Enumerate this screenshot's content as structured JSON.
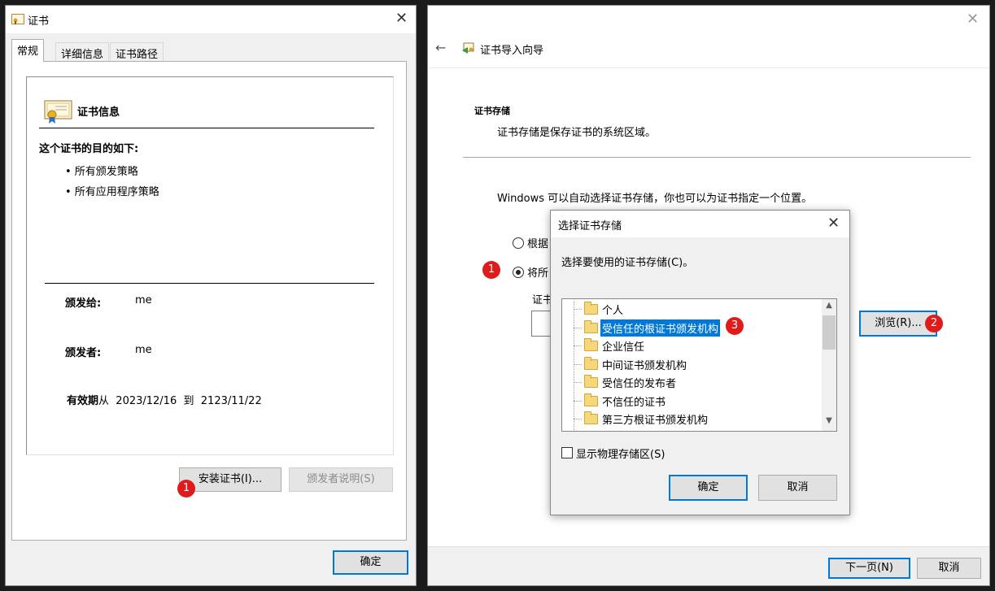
{
  "cert_window": {
    "title": "证书",
    "tabs": [
      "常规",
      "详细信息",
      "证书路径"
    ],
    "info_heading": "证书信息",
    "purpose_heading": "这个证书的目的如下:",
    "purposes": [
      "• 所有颁发策略",
      "• 所有应用程序策略"
    ],
    "issued_to_label": "颁发给:",
    "issued_to_value": "me",
    "issued_by_label": "颁发者:",
    "issued_by_value": "me",
    "validity_label_bold": "有效期",
    "validity_from": "从",
    "validity_start": "2023/12/16",
    "validity_to": "到",
    "validity_end": "2123/11/22",
    "install_button": "安装证书(I)...",
    "issuer_statement_button": "颁发者说明(S)",
    "ok_button": "确定",
    "badge": "1"
  },
  "wizard": {
    "title": "证书导入向导",
    "store_heading": "证书存储",
    "store_desc": "证书存储是保存证书的系统区域。",
    "auto_text": "Windows 可以自动选择证书存储，你也可以为证书指定一个位置。",
    "radio_auto_label": "根据",
    "radio_place_label": "将所",
    "store_label_fragment": "证书",
    "browse_button": "浏览(R)...",
    "next_button": "下一页(N)",
    "cancel_button": "取消",
    "badge1": "1",
    "badge2": "2"
  },
  "dialog": {
    "title": "选择证书存储",
    "prompt": "选择要使用的证书存储(C)。",
    "stores": [
      "个人",
      "受信任的根证书颁发机构",
      "企业信任",
      "中间证书颁发机构",
      "受信任的发布者",
      "不信任的证书",
      "第三方根证书颁发机构"
    ],
    "selected_index": 1,
    "show_physical_label": "显示物理存储区(S)",
    "ok_button": "确定",
    "cancel_button": "取消",
    "badge3": "3"
  }
}
